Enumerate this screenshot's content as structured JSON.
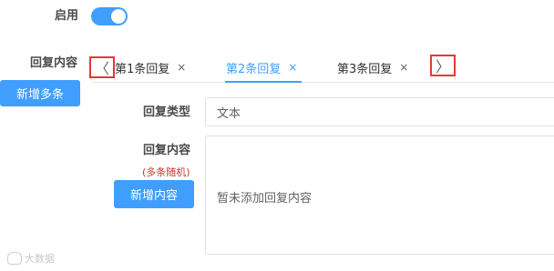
{
  "enable": {
    "label": "启用",
    "state": "on"
  },
  "reply": {
    "label": "回复内容",
    "add_multiple_button": "新增多条",
    "tabs": [
      {
        "label": "第1条回复",
        "close": "×"
      },
      {
        "label": "第2条回复",
        "close": "×",
        "active": true
      },
      {
        "label": "第3条回复",
        "close": "×"
      }
    ],
    "prev_arrow": "〈",
    "next_arrow": "〉"
  },
  "reply_type": {
    "label": "回复类型",
    "value": "文本"
  },
  "reply_content": {
    "label": "回复内容",
    "hint": "(多条随机)",
    "add_content_button": "新增内容",
    "empty_text": "暂未添加回复内容"
  },
  "watermark": {
    "text": "大数据"
  },
  "colors": {
    "primary": "#409eff",
    "highlight_border": "#e53935",
    "hint": "#c0392b"
  }
}
